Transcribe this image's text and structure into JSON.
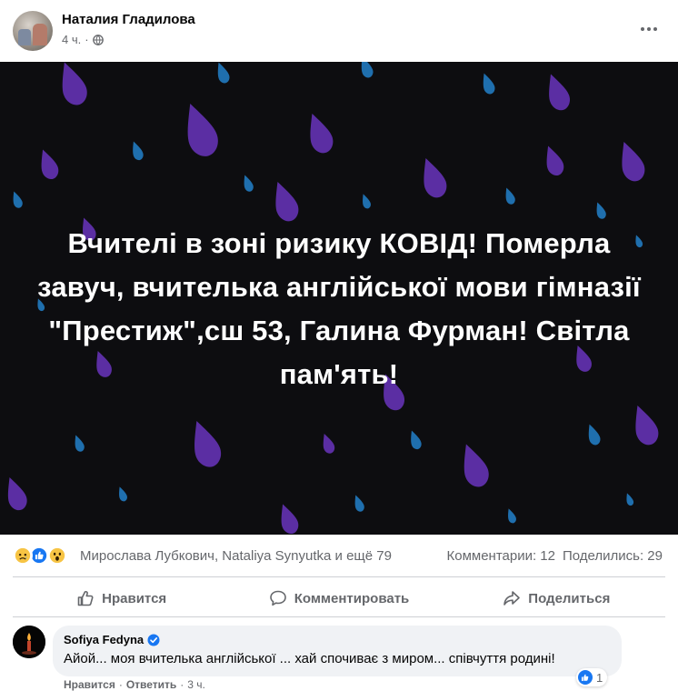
{
  "post": {
    "author": "Наталия Гладилова",
    "time": "4 ч.",
    "separator": "·",
    "privacy_icon": "globe-icon",
    "text": "Вчителі в зоні ризику КОВІД! Померла завуч, вчителька англійської мови гімназії \"Престиж\",сш 53, Галина Фурман! Світла пам'ять!",
    "image_colors": {
      "background": "#0d0d10",
      "drop_purple": "#5b2ea3",
      "drop_blue": "#1f6fae",
      "text": "#ffffff"
    }
  },
  "reactions": {
    "icons": [
      "sad-icon",
      "like-icon",
      "wow-icon"
    ],
    "names": "Мирослава Лубкович, Nataliya Synyutka и ещё 79",
    "comments": "Комментарии: 12",
    "shares": "Поделились: 29"
  },
  "actions": {
    "like": "Нравится",
    "comment": "Комментировать",
    "share": "Поделиться"
  },
  "comment": {
    "author": "Sofiya Fedyna",
    "verified_icon": "verified-badge-icon",
    "text": "Айой... моя вчителька англійської ... хай спочиває з миром... співчуття родині!",
    "like_count": "1",
    "like_action": "Нравится",
    "reply_action": "Ответить",
    "separator": "·",
    "time": "3 ч."
  },
  "colors": {
    "accent": "#1877f2",
    "muted": "#65676b",
    "bubble": "#f0f2f5",
    "divider": "#ced0d4"
  }
}
